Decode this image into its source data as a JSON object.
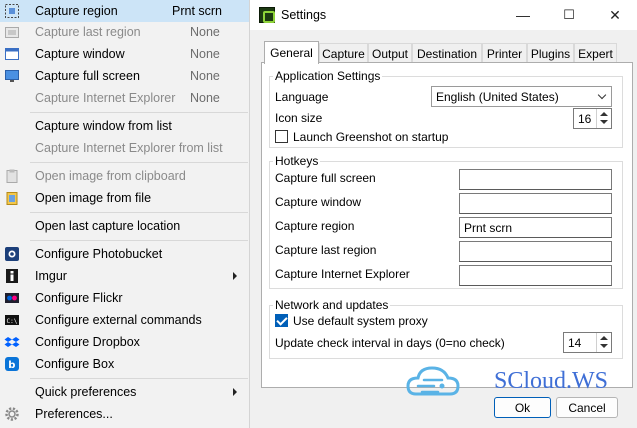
{
  "menu": {
    "items": [
      {
        "label": "Capture region",
        "shortcut": "Prnt scrn",
        "icon": "capture-region-icon",
        "disabled": false,
        "selected": true
      },
      {
        "label": "Capture last region",
        "shortcut": "None",
        "icon": "capture-last-region-icon",
        "disabled": true
      },
      {
        "label": "Capture window",
        "shortcut": "None",
        "icon": "capture-window-icon",
        "disabled": false
      },
      {
        "label": "Capture full screen",
        "shortcut": "None",
        "icon": "capture-fullscreen-icon",
        "disabled": false
      },
      {
        "label": "Capture Internet Explorer",
        "shortcut": "None",
        "icon": "capture-ie-icon",
        "disabled": true
      },
      {
        "label": "Capture window from list",
        "disabled": false
      },
      {
        "label": "Capture Internet Explorer from list",
        "disabled": true
      },
      {
        "label": "Open image from clipboard",
        "icon": "clipboard-icon",
        "disabled": true
      },
      {
        "label": "Open image from file",
        "icon": "folder-icon",
        "disabled": false
      },
      {
        "label": "Open last capture location",
        "disabled": false
      },
      {
        "label": "Configure Photobucket",
        "icon": "photobucket-icon",
        "disabled": false
      },
      {
        "label": "Imgur",
        "icon": "imgur-icon",
        "disabled": false,
        "submenu": true
      },
      {
        "label": "Configure Flickr",
        "icon": "flickr-icon",
        "disabled": false
      },
      {
        "label": "Configure external commands",
        "icon": "terminal-icon",
        "disabled": false
      },
      {
        "label": "Configure Dropbox",
        "icon": "dropbox-icon",
        "disabled": false
      },
      {
        "label": "Configure Box",
        "icon": "box-icon",
        "disabled": false
      },
      {
        "label": "Quick preferences",
        "disabled": false,
        "submenu": true
      },
      {
        "label": "Preferences...",
        "icon": "gear-icon",
        "disabled": false
      }
    ]
  },
  "window": {
    "title": "Settings",
    "controls": {
      "minimize": "—",
      "maximize": "☐",
      "close": "✕"
    },
    "tabs": [
      "General",
      "Capture",
      "Output",
      "Destination",
      "Printer",
      "Plugins",
      "Expert"
    ],
    "active_tab": "General"
  },
  "application_settings": {
    "group_title": "Application Settings",
    "language_label": "Language",
    "language_value": "English (United States)",
    "icon_size_label": "Icon size",
    "icon_size_value": "16",
    "launch_label": "Launch Greenshot on startup",
    "launch_checked": false
  },
  "hotkeys": {
    "group_title": "Hotkeys",
    "rows": [
      {
        "label": "Capture full screen",
        "value": ""
      },
      {
        "label": "Capture window",
        "value": ""
      },
      {
        "label": "Capture region",
        "value": "Prnt scrn"
      },
      {
        "label": "Capture last region",
        "value": ""
      },
      {
        "label": "Capture Internet Explorer",
        "value": ""
      }
    ]
  },
  "network": {
    "group_title": "Network and updates",
    "proxy_label": "Use default system proxy",
    "proxy_checked": true,
    "update_label": "Update check interval in days (0=no check)",
    "update_value": "14"
  },
  "buttons": {
    "ok": "Ok",
    "cancel": "Cancel"
  },
  "watermark": {
    "text": "SCloud.WS",
    "color": "#3f6fd6"
  }
}
